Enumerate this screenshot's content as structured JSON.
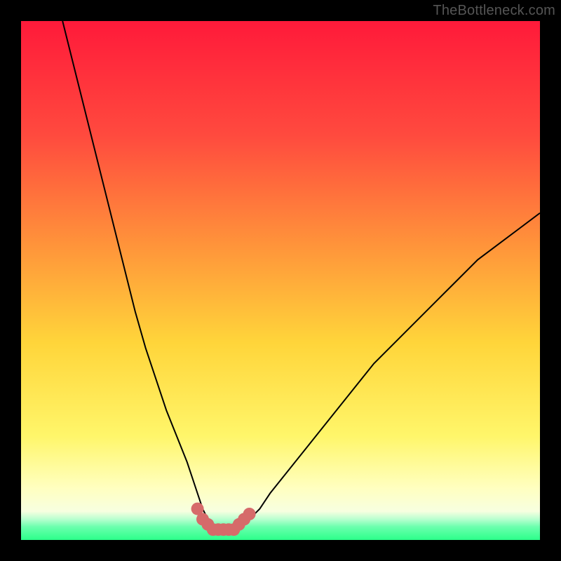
{
  "watermark": "TheBottleneck.com",
  "colors": {
    "frame_bg": "#000000",
    "gradient_top": "#ff1a3a",
    "gradient_mid_upper": "#ff6a3a",
    "gradient_mid": "#ffd53a",
    "gradient_pale": "#ffffb5",
    "gradient_green": "#2cff8a",
    "curve_stroke": "#000000",
    "marker_fill": "#d66a6a"
  },
  "chart_data": {
    "type": "line",
    "title": "",
    "xlabel": "",
    "ylabel": "",
    "xlim": [
      0,
      100
    ],
    "ylim": [
      0,
      100
    ],
    "series": [
      {
        "name": "bottleneck-curve",
        "x": [
          8,
          10,
          12,
          14,
          16,
          18,
          20,
          22,
          24,
          26,
          28,
          30,
          32,
          33,
          34,
          35,
          36,
          37,
          38,
          39,
          40,
          41,
          42,
          43,
          44,
          46,
          48,
          52,
          56,
          60,
          64,
          68,
          72,
          76,
          80,
          84,
          88,
          92,
          96,
          100
        ],
        "y": [
          100,
          92,
          84,
          76,
          68,
          60,
          52,
          44,
          37,
          31,
          25,
          20,
          15,
          12,
          9,
          6,
          4,
          3,
          2,
          2,
          2,
          2,
          2,
          3,
          4,
          6,
          9,
          14,
          19,
          24,
          29,
          34,
          38,
          42,
          46,
          50,
          54,
          57,
          60,
          63
        ]
      }
    ],
    "markers": {
      "name": "bottom-highlight",
      "x": [
        34,
        35,
        36,
        37,
        38,
        39,
        40,
        41,
        42,
        43,
        44
      ],
      "y": [
        6,
        4,
        3,
        2,
        2,
        2,
        2,
        2,
        3,
        4,
        5
      ]
    },
    "gradient_stops": [
      {
        "pos": 0.0,
        "color": "#ff1a3a"
      },
      {
        "pos": 0.22,
        "color": "#ff4a3e"
      },
      {
        "pos": 0.45,
        "color": "#ff9a3a"
      },
      {
        "pos": 0.62,
        "color": "#ffd53a"
      },
      {
        "pos": 0.8,
        "color": "#fff66a"
      },
      {
        "pos": 0.9,
        "color": "#ffffc0"
      },
      {
        "pos": 0.945,
        "color": "#f7ffe0"
      },
      {
        "pos": 0.96,
        "color": "#b8ffcf"
      },
      {
        "pos": 0.975,
        "color": "#6affad"
      },
      {
        "pos": 1.0,
        "color": "#2cff8a"
      }
    ]
  }
}
